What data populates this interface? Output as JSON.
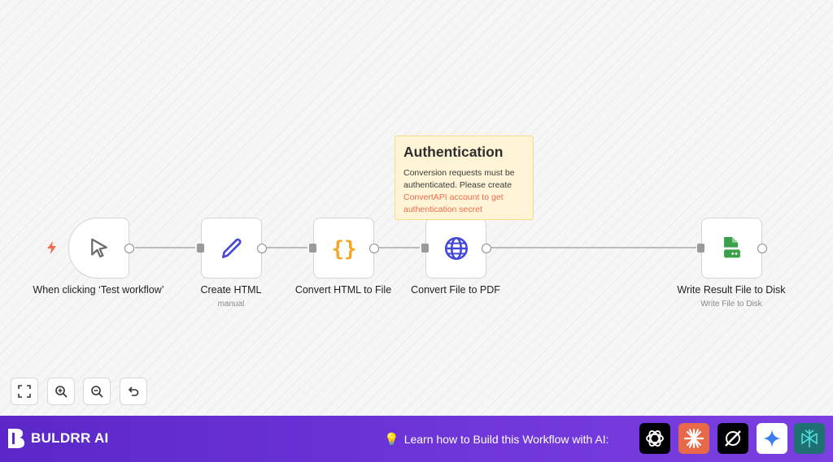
{
  "canvas": {
    "nodes": [
      {
        "id": "trigger",
        "label": "When clicking ‘Test workflow’",
        "subtitle": ""
      },
      {
        "id": "create-html",
        "label": "Create HTML",
        "subtitle": "manual"
      },
      {
        "id": "convert-html",
        "label": "Convert HTML to File",
        "subtitle": ""
      },
      {
        "id": "convert-pdf",
        "label": "Convert File to PDF",
        "subtitle": ""
      },
      {
        "id": "write-file",
        "label": "Write Result File to Disk",
        "subtitle": "Write File to Disk"
      }
    ],
    "sticky_note": {
      "title": "Authentication",
      "body": "Conversion requests must be authenticated. Please create",
      "link": "ConvertAPI account to get authentication secret"
    },
    "zoom_controls": [
      "fit-view",
      "zoom-in",
      "zoom-out",
      "reset"
    ]
  },
  "footer": {
    "brand": "BULDRR AI",
    "cta": "Learn how to Build this Workflow with AI:",
    "ai_tools": [
      {
        "name": "chatgpt",
        "bg": "#000000"
      },
      {
        "name": "claude",
        "bg": "#e8694a"
      },
      {
        "name": "grok",
        "bg": "#000000"
      },
      {
        "name": "gemini",
        "bg": "#ffffff"
      },
      {
        "name": "perplexity",
        "bg": "#1f6f73"
      }
    ]
  },
  "colors": {
    "accent_orange": "#f26b4f",
    "footer_purple": "#5b27c9",
    "globe_blue": "#4247d6",
    "code_orange": "#f5a623",
    "disk_green": "#3aa14a"
  }
}
